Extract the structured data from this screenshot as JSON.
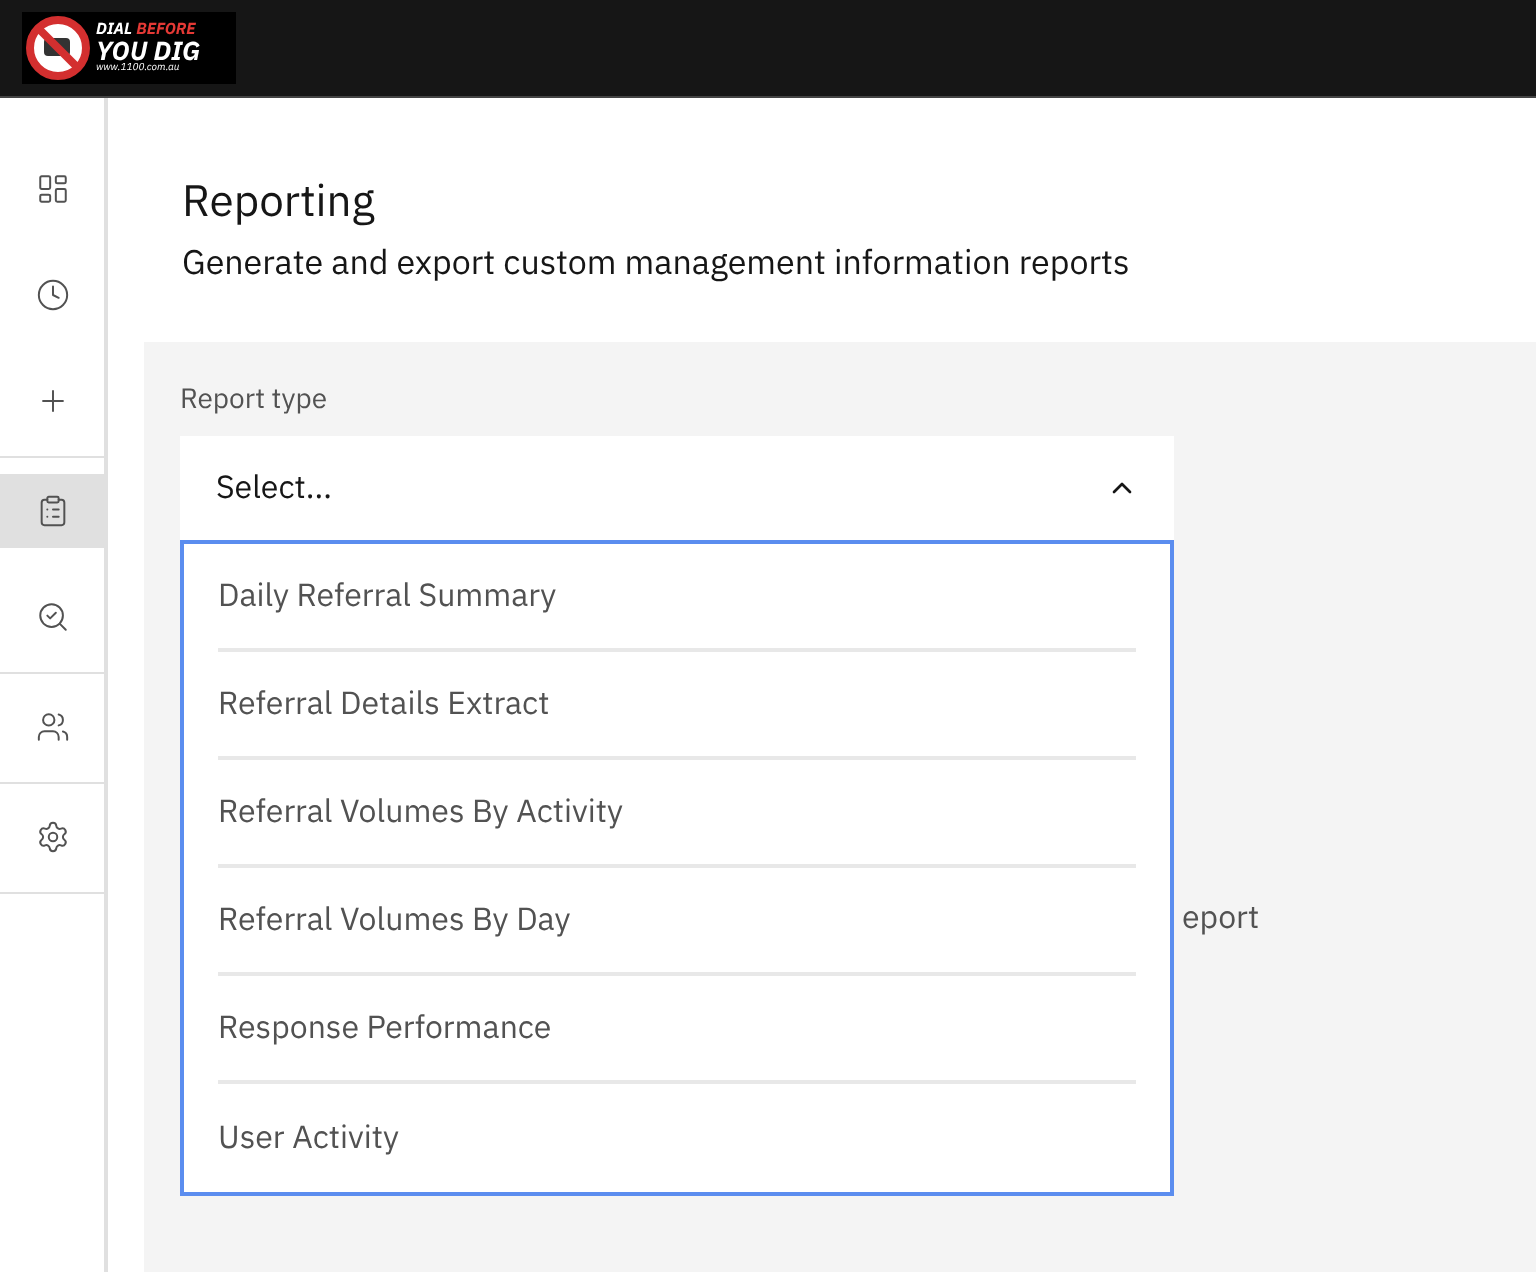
{
  "logo": {
    "line_1a": "DIAL",
    "line_1b": "BEFORE",
    "line_2": "YOU DIG",
    "url": "www.1100.com.au"
  },
  "sidebar": {
    "items": [
      {
        "selected": false
      },
      {
        "selected": false
      },
      {
        "selected": false
      },
      {
        "selected": true
      },
      {
        "selected": false
      },
      {
        "selected": false
      },
      {
        "selected": false
      }
    ]
  },
  "page": {
    "title": "Reporting",
    "subtitle": "Generate and export custom management information reports"
  },
  "form": {
    "label": "Report type",
    "select": {
      "placeholder": "Select...",
      "expanded": true,
      "options": [
        "Daily Referral Summary",
        "Referral Details Extract",
        "Referral Volumes By Activity",
        "Referral Volumes By Day",
        "Response Performance",
        "User Activity"
      ]
    },
    "hidden_text": "eport"
  }
}
